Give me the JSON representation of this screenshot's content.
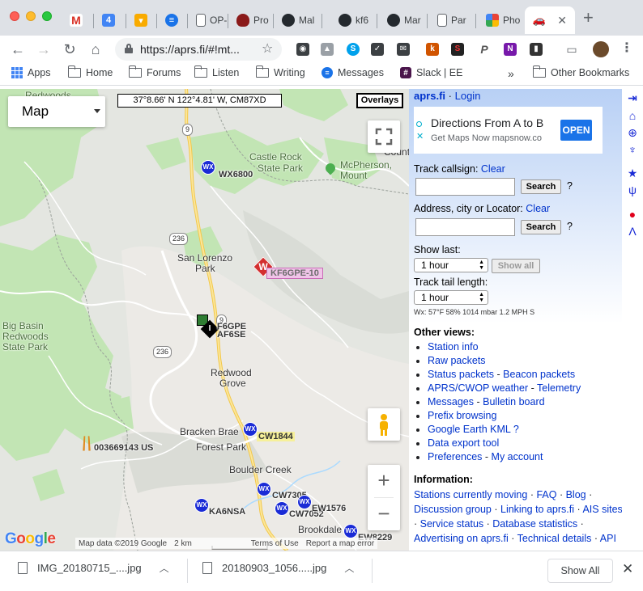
{
  "browser": {
    "tabs": [
      {
        "label": "",
        "icon": "gmail-icon"
      },
      {
        "label": "",
        "icon": "calendar-icon"
      },
      {
        "label": "",
        "icon": "keep-icon"
      },
      {
        "label": "",
        "icon": "messages-icon"
      },
      {
        "label": "OP-",
        "icon": "document-icon"
      },
      {
        "label": "Pro",
        "icon": "shield-icon"
      },
      {
        "label": "Mal",
        "icon": "github-icon"
      },
      {
        "label": "kf6",
        "icon": "github-icon"
      },
      {
        "label": "Mar",
        "icon": "github-icon"
      },
      {
        "label": "Par",
        "icon": "document-icon"
      },
      {
        "label": "Pho",
        "icon": "photos-icon"
      },
      {
        "label": "",
        "icon": "car-icon"
      }
    ],
    "new_tab": "+",
    "url": "https://aprs.fi/#!mt...",
    "bookmarks": [
      {
        "label": "Apps"
      },
      {
        "label": "Home"
      },
      {
        "label": "Forums"
      },
      {
        "label": "Listen"
      },
      {
        "label": "Writing"
      },
      {
        "label": "Messages"
      },
      {
        "label": "Slack | EE"
      }
    ],
    "more_bookmarks": "»",
    "other_bookmarks": "Other Bookmarks"
  },
  "map": {
    "map_type": "Map",
    "coords": "37°8.66' N 122°4.81' W, CM87XD",
    "overlays": "Overlays",
    "zoom_in": "+",
    "zoom_out": "−",
    "places": {
      "redwoods_top": "Redwoods",
      "castle_rock_1": "Castle Rock",
      "castle_rock_2": "State Park",
      "mcpherson_1": "McPherson,",
      "mcpherson_2": "Mount",
      "boulder_county": "County",
      "san_lorenzo_1": "San Lorenzo",
      "san_lorenzo_2": "Park",
      "big_basin_1": "Big Basin",
      "big_basin_2": "Redwoods",
      "big_basin_3": "State Park",
      "redwood_grove_1": "Redwood",
      "redwood_grove_2": "Grove",
      "bracken_brae": "Bracken Brae",
      "forest_park": "Forest Park",
      "boulder_creek": "Boulder Creek",
      "brookdale": "Brookdale",
      "route_9a": "9",
      "route_9b": "9",
      "route_236a": "236",
      "route_236b": "236"
    },
    "stations": {
      "wx6800": "WX6800",
      "kf6gpe10": "KF6GPE-10",
      "f6gpe": "F6GPE",
      "af6se": "AF6SE",
      "cw1844": "CW1844",
      "s003669143": "003669143 US",
      "ka6nsa": "KA6NSA",
      "cw7305": "CW7305",
      "cw7052": "CW7052",
      "ew1576": "EW1576",
      "ew8229": "EW8229"
    },
    "wx_label": "WX",
    "google": "Google",
    "attribution": {
      "map_data": "Map data ©2019 Google",
      "scale": "2 km",
      "terms": "Terms of Use",
      "report": "Report a map error"
    }
  },
  "sidebar": {
    "site": "aprs.fi",
    "separator": "·",
    "login": "Login",
    "ad": {
      "title": "Directions From A to B",
      "subtitle": "Get Maps Now mapsnow.co",
      "button": "OPEN"
    },
    "track_callsign_label": "Track callsign:",
    "clear": "Clear",
    "search": "Search",
    "help": "?",
    "address_label": "Address, city or Locator:",
    "show_last_label": "Show last:",
    "show_last_value": "1 hour",
    "show_all": "Show all",
    "tail_label": "Track tail length:",
    "tail_value": "1 hour",
    "weather": "Wx: 57°F 58% 1014 mbar 1.2 MPH S",
    "other_views_title": "Other views:",
    "other_views": [
      [
        "Station info"
      ],
      [
        "Raw packets"
      ],
      [
        "Status packets",
        "Beacon packets"
      ],
      [
        "APRS/CWOP weather",
        "Telemetry"
      ],
      [
        "Messages",
        "Bulletin board"
      ],
      [
        "Prefix browsing"
      ],
      [
        "Google Earth KML ?"
      ],
      [
        "Data export tool"
      ],
      [
        "Preferences",
        "My account"
      ]
    ],
    "dash": "-",
    "information_title": "Information:",
    "information": [
      "Stations currently moving",
      "FAQ",
      "Blog",
      "Discussion group",
      "Linking to aprs.fi",
      "AIS sites",
      "Service status",
      "Database statistics",
      "Advertising on aprs.fi",
      "Technical details",
      "API"
    ]
  },
  "downloads": {
    "items": [
      {
        "name": "IMG_20180715_....jpg"
      },
      {
        "name": "20180903_1056.....jpg"
      }
    ],
    "show_all": "Show All"
  },
  "colors": {
    "link": "#0033cc",
    "wx_blue": "#1a2bd6",
    "park_green": "#c2e5b4",
    "highlight_pink": "#f0c4e8",
    "route_yellow": "#f6d86b"
  }
}
